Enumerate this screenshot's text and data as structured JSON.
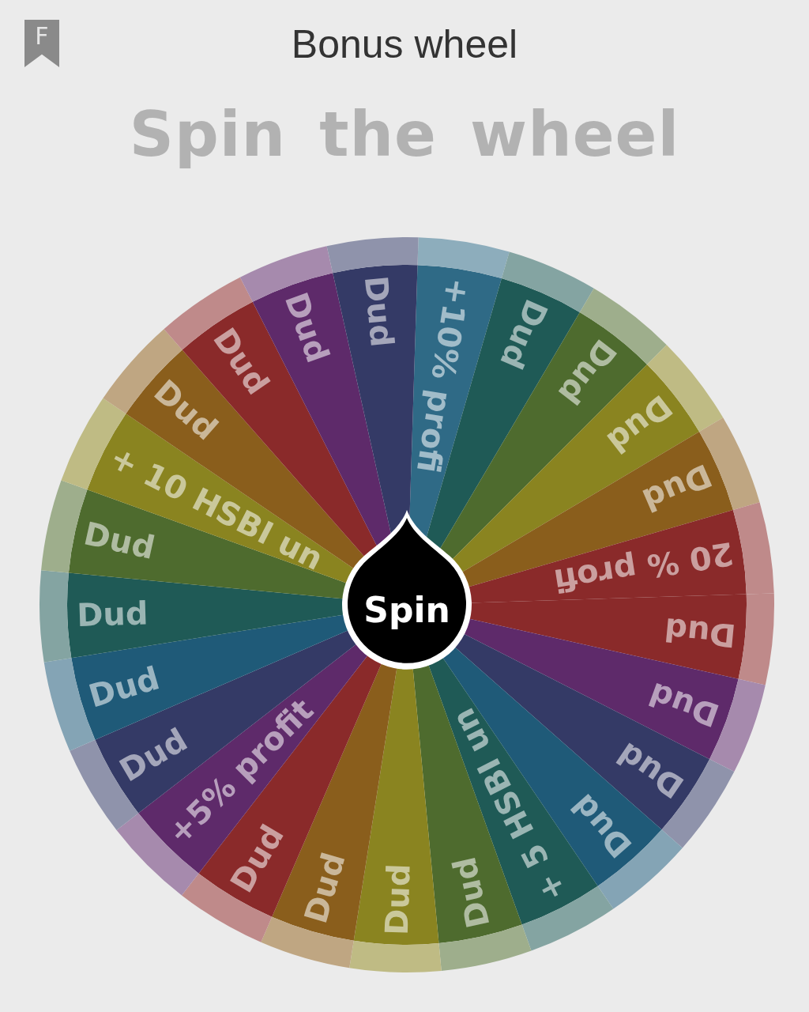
{
  "header": {
    "title": "Bonus wheel",
    "badge": "F"
  },
  "heading": "Spin the wheel",
  "wheel": {
    "button": "Spin",
    "segments": [
      {
        "label": "+10% profi",
        "color": "#2f6a86"
      },
      {
        "label": "Dud",
        "color": "#1f5a56"
      },
      {
        "label": "Dud",
        "color": "#4e6b2e"
      },
      {
        "label": "Dud",
        "color": "#8a8420"
      },
      {
        "label": "Dud",
        "color": "#8a5e1c"
      },
      {
        "label": "20 % profi",
        "color": "#8a2a2a"
      },
      {
        "label": "Dud",
        "color": "#8a2a2a"
      },
      {
        "label": "Dud",
        "color": "#5e2a6a"
      },
      {
        "label": "Dud",
        "color": "#343a66"
      },
      {
        "label": "Dud",
        "color": "#1f5a78"
      },
      {
        "label": "+ 5 HSBI un",
        "color": "#1f5a56"
      },
      {
        "label": "Dud",
        "color": "#4e6b2e"
      },
      {
        "label": "Dud",
        "color": "#8a8420"
      },
      {
        "label": "Dud",
        "color": "#8a5e1c"
      },
      {
        "label": "Dud",
        "color": "#8a2a2a"
      },
      {
        "label": "+5% profit",
        "color": "#5e2a6a"
      },
      {
        "label": "Dud",
        "color": "#343a66"
      },
      {
        "label": "Dud",
        "color": "#1f5a78"
      },
      {
        "label": "Dud",
        "color": "#1f5a56"
      },
      {
        "label": "Dud",
        "color": "#4e6b2e"
      },
      {
        "label": "+ 10 HSBI un",
        "color": "#8a8420"
      },
      {
        "label": "Dud",
        "color": "#8a5e1c"
      },
      {
        "label": "Dud",
        "color": "#8a2a2a"
      },
      {
        "label": "Dud",
        "color": "#5e2a6a"
      },
      {
        "label": "Dud",
        "color": "#343a66"
      }
    ]
  }
}
